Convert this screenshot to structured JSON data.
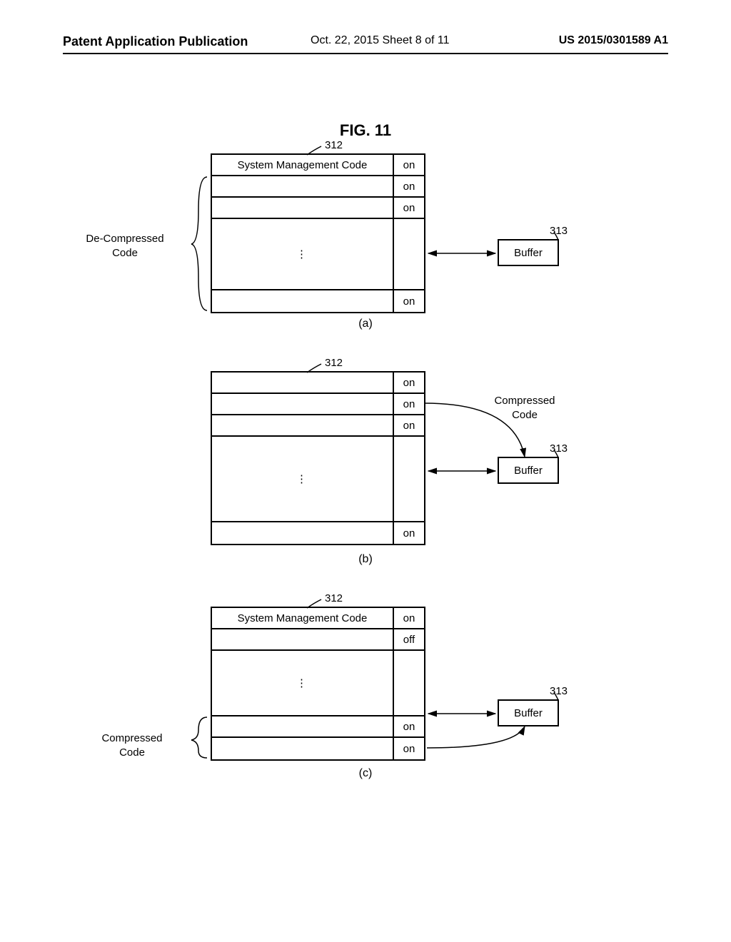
{
  "header": {
    "left": "Patent Application Publication",
    "center": "Oct. 22, 2015  Sheet 8 of 11",
    "right": "US 2015/0301589 A1"
  },
  "figure_title": "FIG.  11",
  "ref": {
    "r312": "312",
    "r313": "313"
  },
  "labels": {
    "decompressed": "De-Compressed\nCode",
    "compressed": "Compressed\nCode",
    "buffer": "Buffer",
    "smc": "System Management Code",
    "on": "on",
    "off": "off",
    "vdots": "⋮"
  },
  "sub": {
    "a": "(a)",
    "b": "(b)",
    "c": "(c)"
  }
}
